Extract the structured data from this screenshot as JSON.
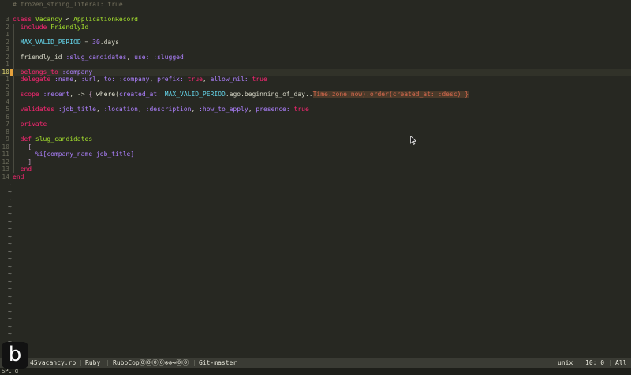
{
  "editor": {
    "lines": [
      {
        "n": "",
        "html": "<span class='cmt'># frozen_string_literal: true</span>"
      },
      {
        "n": "",
        "html": ""
      },
      {
        "n": "3",
        "html": "<span class='kw'>class</span> <span class='cls'>Vacancy</span> &lt; <span class='cls'>ApplicationRecord</span>"
      },
      {
        "n": "2",
        "html": "  <span class='kw'>include</span> <span class='cls'>FriendlyId</span>"
      },
      {
        "n": "1",
        "html": ""
      },
      {
        "n": "2",
        "html": "  <span class='const'>MAX_VALID_PERIOD</span> = <span class='num'>30</span>.days"
      },
      {
        "n": "3",
        "html": ""
      },
      {
        "n": "2",
        "html": "  friendly_id <span class='sym'>:slug_candidates</span>, <span class='sym'>use:</span> <span class='sym'>:slugged</span>"
      },
      {
        "n": "1",
        "html": ""
      },
      {
        "n": "10",
        "html": "  <span class='kw'>belongs_to</span> <span class='sym'>:company</span>",
        "current": true
      },
      {
        "n": "1",
        "html": "  <span class='kw'>delegate</span> <span class='sym'>:name</span>, <span class='sym'>:url</span>, <span class='sym'>to:</span> <span class='sym'>:company</span>, <span class='sym'>prefix:</span> <span class='kw'>true</span>, <span class='sym'>allow_nil:</span> <span class='kw'>true</span>"
      },
      {
        "n": "2",
        "html": ""
      },
      {
        "n": "3",
        "html": "  <span class='kw'>scope</span> <span class='sym'>:recent</span>, -&gt; <span class='brk'>{</span> <span class='fn'>where</span>(<span class='sym'>created_at:</span> <span class='const'>MAX_VALID_PERIOD</span>.ago.beginning_of_day..<span class='hl'>Time.zone.now).order(created_at: :desc) }</span>"
      },
      {
        "n": "4",
        "html": ""
      },
      {
        "n": "5",
        "html": "  <span class='kw'>validates</span> <span class='sym'>:job_title</span>, <span class='sym'>:location</span>, <span class='sym'>:description</span>, <span class='sym'>:how_to_apply</span>, <span class='sym'>presence:</span> <span class='kw'>true</span>"
      },
      {
        "n": "6",
        "html": ""
      },
      {
        "n": "7",
        "html": "  <span class='kw'>private</span>"
      },
      {
        "n": "8",
        "html": ""
      },
      {
        "n": "9",
        "html": "  <span class='kw'>def</span> <span class='cls'>slug_candidates</span>"
      },
      {
        "n": "10",
        "html": "    <span class='brk'>[</span>"
      },
      {
        "n": "11",
        "html": "      <span class='sym'>%i[company_name job_title]</span>"
      },
      {
        "n": "12",
        "html": "    <span class='brk'>]</span>"
      },
      {
        "n": "13",
        "html": "  <span class='kw'>end</span>"
      },
      {
        "n": "14",
        "html": "<span class='kw'>end</span>"
      }
    ],
    "tilde_char": "~",
    "tilde_count": 24
  },
  "statusbar": {
    "mode_num": "45",
    "filename": "vacancy.rb",
    "filetype": "Ruby",
    "linter": "RuboCop⓪⓪⓪⓪⊗⊗⊸⓪⓪",
    "branch": "Git-master",
    "format": "unix",
    "position": "10: 0",
    "scroll": "All"
  },
  "cmdline": {
    "text": "SPC d"
  },
  "logo": {
    "letter": "b"
  },
  "colors": {
    "background": "#272822",
    "statusbar": "#3a3b34",
    "keyword": "#f92672"
  }
}
